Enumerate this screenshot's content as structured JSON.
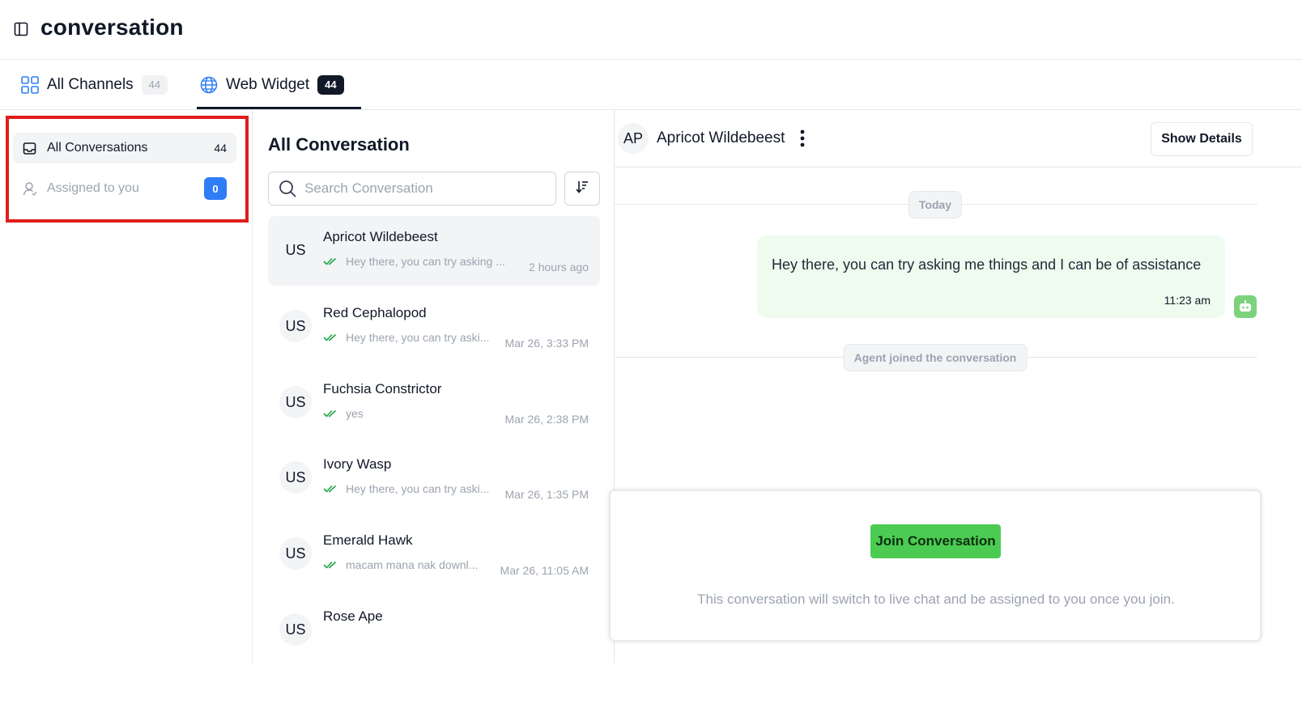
{
  "header": {
    "title": "conversation",
    "toggle_icon": "sidebar-panel-icon"
  },
  "tabs": [
    {
      "label": "All Channels",
      "count": "44",
      "icon": "grid-icon",
      "active": false
    },
    {
      "label": "Web Widget",
      "count": "44",
      "icon": "globe-icon",
      "active": true
    }
  ],
  "filters": [
    {
      "label": "All Conversations",
      "count": "44",
      "icon": "inbox-icon",
      "active": true
    },
    {
      "label": "Assigned to you",
      "count": "0",
      "icon": "user-icon",
      "active": false
    }
  ],
  "list": {
    "title": "All Conversation",
    "search_placeholder": "Search Conversation",
    "conversations": [
      {
        "avatar": "US",
        "name": "Apricot Wildebeest",
        "preview": "Hey there, you can try asking ...",
        "time": "2 hours ago",
        "selected": true
      },
      {
        "avatar": "US",
        "name": "Red Cephalopod",
        "preview": "Hey there, you can try aski...",
        "time": "Mar 26, 3:33 PM",
        "selected": false
      },
      {
        "avatar": "US",
        "name": "Fuchsia Constrictor",
        "preview": "yes",
        "time": "Mar 26, 2:38 PM",
        "selected": false
      },
      {
        "avatar": "US",
        "name": "Ivory Wasp",
        "preview": "Hey there, you can try aski...",
        "time": "Mar 26, 1:35 PM",
        "selected": false
      },
      {
        "avatar": "US",
        "name": "Emerald Hawk",
        "preview": "macam mana nak downl...",
        "time": "Mar 26, 11:05 AM",
        "selected": false
      },
      {
        "avatar": "US",
        "name": "Rose Ape",
        "preview": "",
        "time": "",
        "selected": false
      }
    ]
  },
  "chat": {
    "avatar": "AP",
    "name": "Apricot Wildebeest",
    "show_details_label": "Show Details",
    "date_divider": "Today",
    "message": {
      "text": "Hey there, you can try asking me things and I can be of assistance",
      "time": "11:23 am",
      "sender_icon": "robot-icon"
    },
    "event_divider": "Agent joined the conversation",
    "join_button_label": "Join Conversation",
    "join_note": "This conversation will switch to live chat and be assigned to you once you join."
  },
  "colors": {
    "highlight": "#e11d1d",
    "join_button": "#4ccb52",
    "bubble": "#effbef",
    "badge_blue": "#2f7df6",
    "check_green": "#22a34a"
  }
}
